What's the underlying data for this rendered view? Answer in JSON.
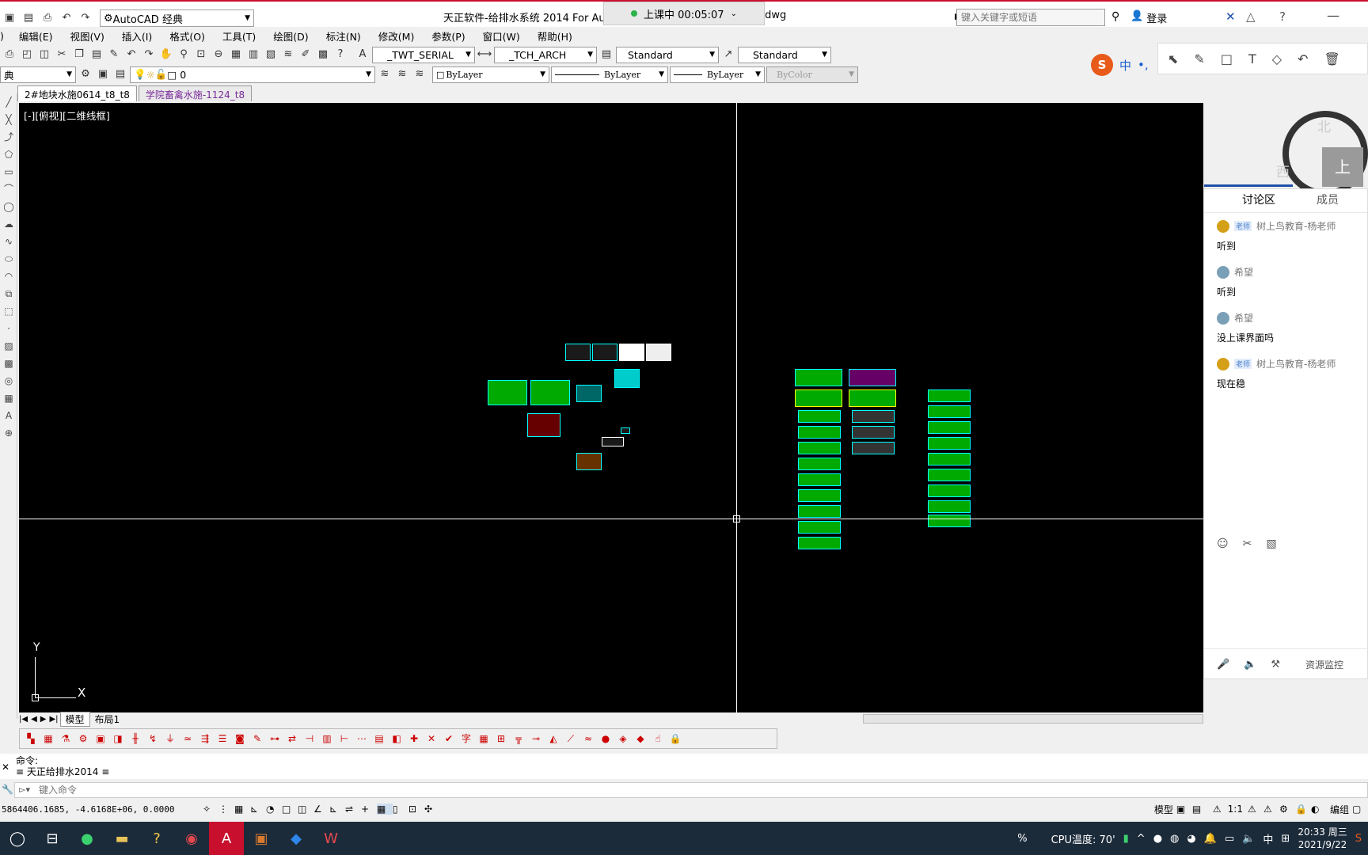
{
  "titlebar": {
    "workspace": "AutoCAD 经典",
    "app_title": "天正软件-给排水系统 2014 For AutoC",
    "app_title_tail": ".dwg",
    "class_status": "上课中 00:05:07",
    "search_placeholder": "键入关键字或短语",
    "login": "登录"
  },
  "menubar": [
    "编辑(E)",
    "视图(V)",
    "插入(I)",
    "格式(O)",
    "工具(T)",
    "绘图(D)",
    "标注(N)",
    "修改(M)",
    "参数(P)",
    "窗口(W)",
    "帮助(H)"
  ],
  "menubar_first": ")",
  "toolbar": {
    "text_style": "_TWT_SERIAL",
    "dim_style": "_TCH_ARCH",
    "table_style": "Standard",
    "multileader_style": "Standard"
  },
  "properties": {
    "layer_field": "典",
    "current_layer": "0",
    "color": "ByLayer",
    "linetype": "ByLayer",
    "lineweight": "ByLayer",
    "plotstyle": "ByColor"
  },
  "file_tabs": [
    "2#地块水施0614_t8_t8",
    "学院畜禽水施-1124_t8"
  ],
  "viewport_label": "[-][俯视][二维线框]",
  "compass": {
    "north": "北",
    "west": "西",
    "cube_face": "上"
  },
  "ucs": {
    "y": "Y",
    "x": "X"
  },
  "layout_tabs": [
    "模型",
    "布局1"
  ],
  "command": {
    "history_1": "命令:",
    "history_2": "≡ 天正给排水2014 ≡",
    "prompt_placeholder": "键入命令"
  },
  "status": {
    "coords": "5864406.1685, -4.6168E+06, 0.0000",
    "model": "模型",
    "scale": "1:1",
    "edit_group": "编组"
  },
  "chat": {
    "tab_discuss": "讨论区",
    "tab_members": "成员",
    "messages": [
      {
        "sender": "树上鸟教育-杨老师",
        "badge": "老师",
        "text": "听到",
        "teacher": true
      },
      {
        "sender": "希望",
        "badge": "",
        "text": "听到",
        "teacher": false
      },
      {
        "sender": "希望",
        "badge": "",
        "text": "没上课界面吗",
        "teacher": false
      },
      {
        "sender": "树上鸟教育-杨老师",
        "badge": "老师",
        "text": "现在稳",
        "teacher": true
      }
    ],
    "resource_monitor": "资源监控"
  },
  "ime": {
    "logo": "S",
    "mode": "中"
  },
  "taskbar": {
    "percent": "%",
    "cpu_temp": "CPU温度: 70'",
    "lang": "中",
    "time": "20:33 周三",
    "date": "2021/9/22"
  },
  "colors": {
    "accent_red": "#c8102e",
    "canvas": "#000000",
    "sheet_cyan": "#00ffff",
    "sheet_green": "#00ff00"
  }
}
